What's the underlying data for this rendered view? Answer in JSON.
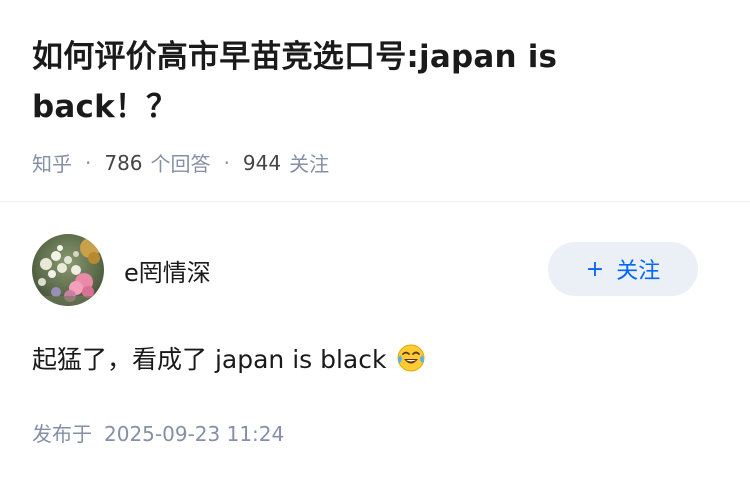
{
  "question": {
    "title": "如何评价高市早苗竞选口号:japan is back！？",
    "meta": {
      "site": "知乎",
      "answers_count": "786",
      "answers_label": "个回答",
      "followers_count": "944",
      "followers_label": "关注",
      "separator": "·"
    }
  },
  "answer": {
    "author": {
      "name": "e罔情深",
      "avatar_icon": "flower-bouquet-avatar"
    },
    "follow_button": {
      "label": "关注",
      "icon": "plus-icon"
    },
    "content": "起猛了，看成了 japan is black",
    "emoji": "tears-of-joy-emoji",
    "published": {
      "label": "发布于",
      "time": "2025-09-23 11:24"
    }
  },
  "colors": {
    "accent": "#0066ff",
    "follow_bg": "#ebf0f7",
    "meta": "#8590a6",
    "text": "#1a1a1a"
  }
}
